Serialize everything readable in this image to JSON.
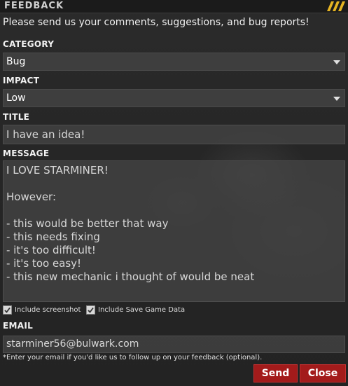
{
  "window": {
    "title": "FEEDBACK",
    "intro": "Please send us your comments, suggestions, and bug reports!"
  },
  "category": {
    "label": "CATEGORY",
    "value": "Bug"
  },
  "impact": {
    "label": "IMPACT",
    "value": "Low"
  },
  "title_field": {
    "label": "TITLE",
    "value": "I have an idea!"
  },
  "message": {
    "label": "MESSAGE",
    "lines": [
      "I LOVE STARMINER!",
      "",
      "However:",
      "",
      "- this would be better that way",
      "- this needs fixing",
      "- it's too difficult!",
      "- it's too easy!",
      "- this new mechanic i thought of would be neat"
    ]
  },
  "options": {
    "include_screenshot": "Include screenshot",
    "include_save": "Include Save Game Data"
  },
  "email": {
    "label": "EMAIL",
    "value": "starminer56@bulwark.com",
    "note": "*Enter your email if you'd like us to follow up on your feedback (optional)."
  },
  "buttons": {
    "send": "Send",
    "close": "Close"
  },
  "colors": {
    "accent_button": "#a31b1b",
    "stripe_yellow": "#e6b422"
  }
}
